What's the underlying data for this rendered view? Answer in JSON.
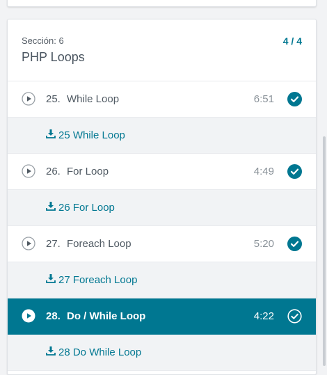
{
  "colors": {
    "accent": "#007791",
    "page_bg": "#f2f3f5",
    "resource_bg": "#f1f3f5"
  },
  "section": {
    "subtitle": "Sección: 6",
    "title": "PHP Loops",
    "progress": "4 / 4"
  },
  "lessons": [
    {
      "number": "25.",
      "title": "While Loop",
      "duration": "6:51",
      "completed": true,
      "active": false,
      "resource": "25 While Loop"
    },
    {
      "number": "26.",
      "title": "For Loop",
      "duration": "4:49",
      "completed": true,
      "active": false,
      "resource": "26 For Loop"
    },
    {
      "number": "27.",
      "title": "Foreach Loop",
      "duration": "5:20",
      "completed": true,
      "active": false,
      "resource": "27 Foreach Loop"
    },
    {
      "number": "28.",
      "title": "Do / While Loop",
      "duration": "4:22",
      "completed": true,
      "active": true,
      "resource": "28 Do While Loop"
    }
  ],
  "icons": {
    "play": "play-circle-icon",
    "check": "check-circle-icon",
    "download": "download-icon"
  }
}
